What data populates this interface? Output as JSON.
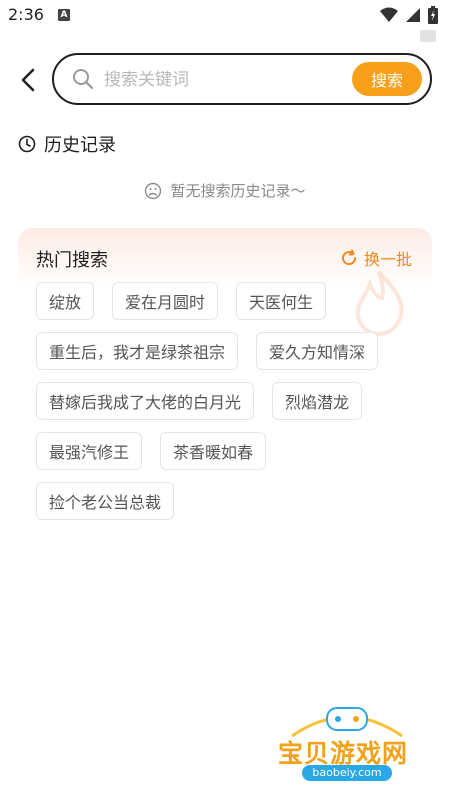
{
  "status_bar": {
    "time": "2:36",
    "notification_letter": "A"
  },
  "search": {
    "placeholder": "搜索关键词",
    "value": "",
    "button_label": "搜索"
  },
  "history": {
    "title": "历史记录",
    "empty_text": "暂无搜索历史记录～"
  },
  "hot": {
    "title": "热门搜索",
    "refresh_label": "换一批",
    "tags": [
      "绽放",
      "爱在月圆时",
      "天医何生",
      "重生后，我才是绿茶祖宗",
      "爱久方知情深",
      "替嫁后我成了大佬的白月光",
      "烈焰潜龙",
      "最强汽修王",
      "茶香暖如春",
      "捡个老公当总裁"
    ]
  },
  "watermark": {
    "text": "宝贝游戏网",
    "url": "baobeiy.com"
  },
  "colors": {
    "accent": "#f9a01b",
    "refresh": "#f08a1c",
    "card_gradient_top": "#fdebe4"
  }
}
